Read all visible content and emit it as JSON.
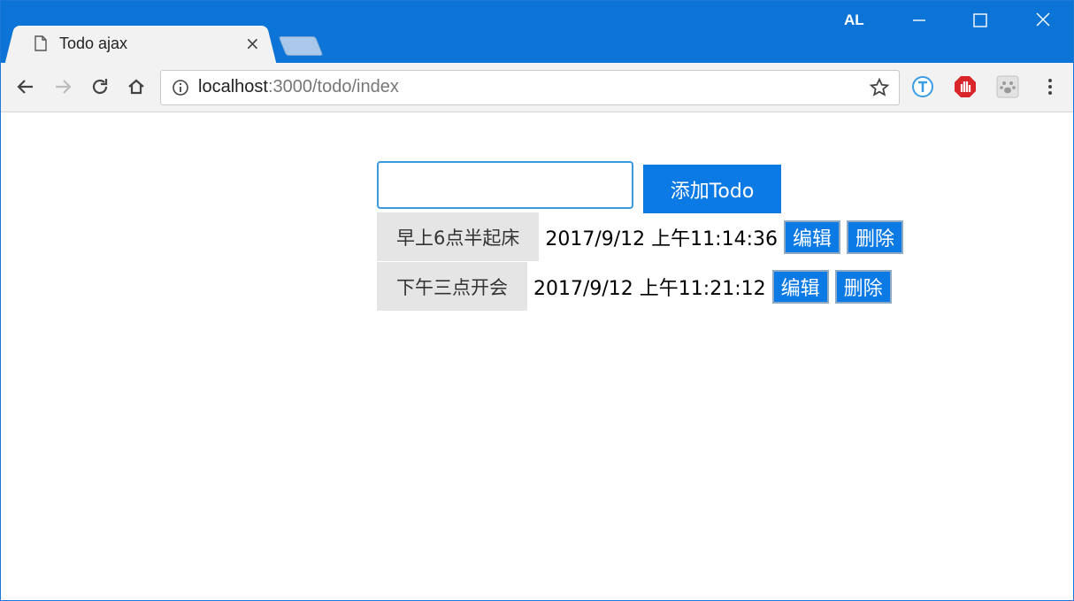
{
  "browser": {
    "tab_title": "Todo ajax",
    "tab_close": "×",
    "profile": "AL",
    "url_host": "localhost",
    "url_path": ":3000/todo/index"
  },
  "form": {
    "input_value": "",
    "add_label": "添加Todo"
  },
  "todos": [
    {
      "text": "早上6点半起床",
      "time": "2017/9/12 上午11:14:36",
      "edit": "编辑",
      "delete": "删除"
    },
    {
      "text": "下午三点开会",
      "time": "2017/9/12 上午11:21:12",
      "edit": "编辑",
      "delete": "删除"
    }
  ],
  "colors": {
    "accent": "#0c7ae5",
    "titlebar": "#0b74d6",
    "todo_bg": "#e5e5e5"
  }
}
